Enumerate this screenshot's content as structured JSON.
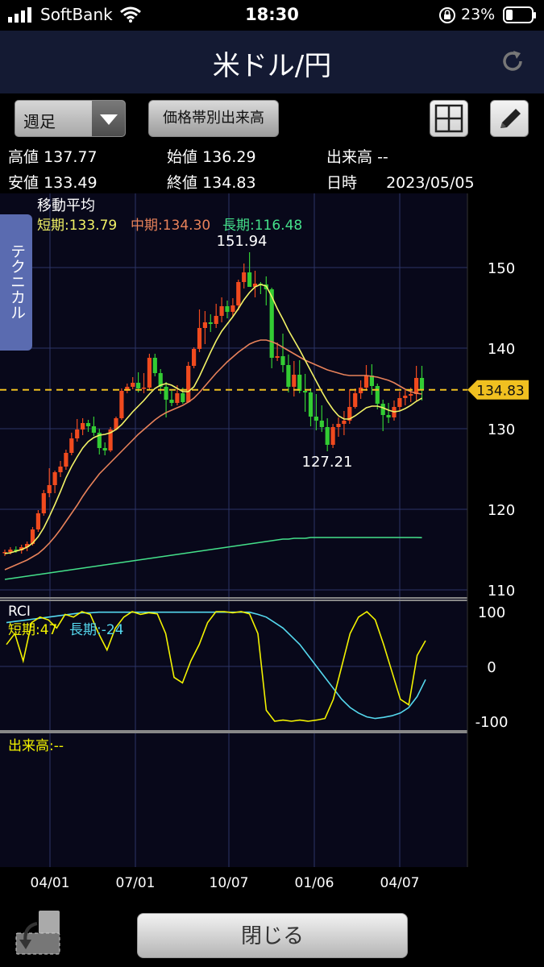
{
  "status_bar": {
    "carrier": "SoftBank",
    "time": "18:30",
    "battery": "23%"
  },
  "header": {
    "title": "米ドル/円"
  },
  "toolbar": {
    "period": "週足",
    "volume_button": "価格帯別出来高"
  },
  "ohlc": {
    "high_label": "高値",
    "high": "137.77",
    "open_label": "始値",
    "open": "136.29",
    "volume_label": "出来高",
    "volume": "--",
    "low_label": "安値",
    "low": "133.49",
    "close_label": "終値",
    "close": "134.83",
    "date_label": "日時",
    "date": "2023/05/05"
  },
  "side_tab": {
    "label": "テクニカル"
  },
  "close_button": {
    "label": "閉じる"
  },
  "colors": {
    "up": "#f04a1e",
    "down": "#33cc33",
    "ma_short": "#f2f266",
    "ma_mid": "#e8825a",
    "ma_long": "#44e08a",
    "rci_short": "#f2f200",
    "rci_long": "#55d8ee",
    "grid": "#2c3566",
    "price_tag": "#f0c020"
  },
  "chart_data": [
    {
      "type": "candlestick",
      "title": "移動平均",
      "legend": [
        {
          "label": "短期",
          "value": "133.79"
        },
        {
          "label": "中期",
          "value": "134.30"
        },
        {
          "label": "長期",
          "value": "116.48"
        }
      ],
      "x_ticks": [
        "04/01",
        "07/01",
        "10/07",
        "01/06",
        "04/07"
      ],
      "y_ticks": [
        110,
        120,
        130,
        140,
        150
      ],
      "ylim": [
        109,
        158
      ],
      "current_price": 134.83,
      "current_price_label": "134.83",
      "high_annotation": {
        "value": 151.94,
        "label": "151.94"
      },
      "low_annotation": {
        "value": 127.21,
        "label": "127.21"
      },
      "candles": [
        [
          114.6,
          115.0,
          114.2,
          114.7
        ],
        [
          114.7,
          115.3,
          114.4,
          115.0
        ],
        [
          115.0,
          115.4,
          114.6,
          114.9
        ],
        [
          114.9,
          115.6,
          114.5,
          115.3
        ],
        [
          115.3,
          116.0,
          114.8,
          115.7
        ],
        [
          115.7,
          117.8,
          115.5,
          117.5
        ],
        [
          117.5,
          119.9,
          117.2,
          119.5
        ],
        [
          119.5,
          122.4,
          119.2,
          122.0
        ],
        [
          122.0,
          125.1,
          121.5,
          123.0
        ],
        [
          123.0,
          124.8,
          122.0,
          124.6
        ],
        [
          124.6,
          126.0,
          124.0,
          125.3
        ],
        [
          125.3,
          127.4,
          124.9,
          127.0
        ],
        [
          127.0,
          129.5,
          126.7,
          128.8
        ],
        [
          128.8,
          131.2,
          128.4,
          129.9
        ],
        [
          129.9,
          131.3,
          129.2,
          130.7
        ],
        [
          130.7,
          131.1,
          129.6,
          130.3
        ],
        [
          130.3,
          131.5,
          129.1,
          129.5
        ],
        [
          129.5,
          130.0,
          126.8,
          127.6
        ],
        [
          127.6,
          128.3,
          126.7,
          127.3
        ],
        [
          127.3,
          130.2,
          127.1,
          129.9
        ],
        [
          129.9,
          131.5,
          129.8,
          131.3
        ],
        [
          131.3,
          135.0,
          131.1,
          134.7
        ],
        [
          134.7,
          135.6,
          134.4,
          135.2
        ],
        [
          135.2,
          136.4,
          134.9,
          135.7
        ],
        [
          135.7,
          137.0,
          134.5,
          135.0
        ],
        [
          135.0,
          136.9,
          134.4,
          135.1
        ],
        [
          135.1,
          139.3,
          134.9,
          138.8
        ],
        [
          138.8,
          139.3,
          136.5,
          136.9
        ],
        [
          136.9,
          137.4,
          134.3,
          135.2
        ],
        [
          135.2,
          135.8,
          131.4,
          133.6
        ],
        [
          133.6,
          134.7,
          132.8,
          133.2
        ],
        [
          133.2,
          135.4,
          132.9,
          134.4
        ],
        [
          134.4,
          135.1,
          133.1,
          133.3
        ],
        [
          133.3,
          138.3,
          133.2,
          137.8
        ],
        [
          137.8,
          140.1,
          137.5,
          139.9
        ],
        [
          139.9,
          144.8,
          139.5,
          142.5
        ],
        [
          142.5,
          144.6,
          140.5,
          143.2
        ],
        [
          143.2,
          144.2,
          142.0,
          143.0
        ],
        [
          143.0,
          145.5,
          142.5,
          144.0
        ],
        [
          144.0,
          146.3,
          143.2,
          145.2
        ],
        [
          145.2,
          145.9,
          143.7,
          144.5
        ],
        [
          144.5,
          146.2,
          143.9,
          145.3
        ],
        [
          145.3,
          148.5,
          144.7,
          148.2
        ],
        [
          148.2,
          150.5,
          147.4,
          149.4
        ],
        [
          149.4,
          151.9,
          148.8,
          147.6
        ],
        [
          147.6,
          149.6,
          146.3,
          148.0
        ],
        [
          148.0,
          148.2,
          146.7,
          147.9
        ],
        [
          147.9,
          148.9,
          145.3,
          147.3
        ],
        [
          147.3,
          147.5,
          137.5,
          138.8
        ],
        [
          138.8,
          140.7,
          138.4,
          139.0
        ],
        [
          139.0,
          141.8,
          137.0,
          137.9
        ],
        [
          137.9,
          139.2,
          134.5,
          135.2
        ],
        [
          135.2,
          138.4,
          134.0,
          136.7
        ],
        [
          136.7,
          138.5,
          134.4,
          134.7
        ],
        [
          134.7,
          136.8,
          132.1,
          134.5
        ],
        [
          134.5,
          135.0,
          130.3,
          131.5
        ],
        [
          131.5,
          134.3,
          129.8,
          131.0
        ],
        [
          131.0,
          132.9,
          129.6,
          130.2
        ],
        [
          130.2,
          131.3,
          127.2,
          128.0
        ],
        [
          128.0,
          130.6,
          127.6,
          130.2
        ],
        [
          130.2,
          131.4,
          129.0,
          130.6
        ],
        [
          130.6,
          132.2,
          129.2,
          131.0
        ],
        [
          131.0,
          134.9,
          130.6,
          132.7
        ],
        [
          132.7,
          135.0,
          132.5,
          134.4
        ],
        [
          134.4,
          136.0,
          133.7,
          135.1
        ],
        [
          135.1,
          137.9,
          134.7,
          136.6
        ],
        [
          136.6,
          138.0,
          134.2,
          135.3
        ],
        [
          135.3,
          135.6,
          132.4,
          133.1
        ],
        [
          133.1,
          133.6,
          129.7,
          131.7
        ],
        [
          131.7,
          133.2,
          130.7,
          131.4
        ],
        [
          131.4,
          133.5,
          131.0,
          132.7
        ],
        [
          132.7,
          134.6,
          132.2,
          133.8
        ],
        [
          133.8,
          134.8,
          132.9,
          134.1
        ],
        [
          134.1,
          135.1,
          133.3,
          134.3
        ],
        [
          134.3,
          137.8,
          133.5,
          136.3
        ],
        [
          136.3,
          137.8,
          133.5,
          134.8
        ]
      ],
      "ma_short": [
        114.5,
        114.6,
        114.8,
        115.0,
        115.3,
        115.8,
        116.6,
        117.7,
        119.1,
        120.6,
        122.2,
        123.9,
        125.3,
        126.5,
        127.6,
        128.4,
        128.9,
        129.2,
        129.3,
        129.5,
        129.9,
        130.5,
        131.3,
        132.1,
        132.8,
        133.5,
        134.3,
        135.0,
        135.4,
        135.6,
        135.4,
        135.0,
        134.6,
        134.6,
        135.2,
        136.5,
        138.0,
        139.5,
        140.9,
        142.1,
        143.0,
        143.9,
        144.9,
        146.0,
        146.9,
        147.6,
        147.9,
        147.7,
        146.4,
        144.9,
        143.6,
        142.2,
        141.0,
        139.8,
        138.5,
        137.2,
        135.9,
        134.6,
        133.4,
        132.4,
        131.6,
        131.2,
        131.2,
        131.6,
        132.1,
        132.6,
        132.8,
        132.8,
        132.6,
        132.3,
        132.1,
        132.2,
        132.5,
        132.9,
        133.4,
        133.79
      ],
      "ma_mid": [
        112.5,
        112.8,
        113.1,
        113.4,
        113.7,
        114.1,
        114.5,
        115.1,
        115.8,
        116.6,
        117.5,
        118.5,
        119.5,
        120.5,
        121.6,
        122.6,
        123.5,
        124.4,
        125.1,
        125.8,
        126.5,
        127.2,
        127.9,
        128.6,
        129.3,
        129.9,
        130.5,
        131.1,
        131.6,
        132.0,
        132.3,
        132.6,
        132.9,
        133.3,
        133.8,
        134.5,
        135.3,
        136.1,
        136.9,
        137.6,
        138.3,
        138.9,
        139.5,
        140.0,
        140.5,
        140.8,
        141.0,
        141.0,
        140.8,
        140.5,
        140.1,
        139.7,
        139.3,
        138.9,
        138.5,
        138.2,
        137.9,
        137.6,
        137.3,
        137.1,
        136.9,
        136.7,
        136.6,
        136.6,
        136.6,
        136.6,
        136.5,
        136.4,
        136.2,
        136.0,
        135.7,
        135.3,
        134.9,
        134.6,
        134.4,
        134.3
      ],
      "ma_long": [
        111.3,
        111.4,
        111.5,
        111.6,
        111.7,
        111.8,
        111.9,
        112.0,
        112.1,
        112.2,
        112.3,
        112.4,
        112.5,
        112.6,
        112.7,
        112.8,
        112.9,
        113.0,
        113.1,
        113.2,
        113.3,
        113.4,
        113.5,
        113.6,
        113.7,
        113.8,
        113.9,
        114.0,
        114.1,
        114.2,
        114.3,
        114.4,
        114.5,
        114.6,
        114.7,
        114.8,
        114.9,
        115.0,
        115.1,
        115.2,
        115.3,
        115.4,
        115.5,
        115.6,
        115.7,
        115.8,
        115.9,
        116.0,
        116.1,
        116.2,
        116.3,
        116.3,
        116.4,
        116.4,
        116.4,
        116.5,
        116.5,
        116.5,
        116.5,
        116.5,
        116.5,
        116.5,
        116.5,
        116.5,
        116.5,
        116.5,
        116.5,
        116.5,
        116.5,
        116.5,
        116.5,
        116.5,
        116.5,
        116.5,
        116.5,
        116.48
      ]
    },
    {
      "type": "line",
      "title": "RCI",
      "legend": [
        {
          "label": "短期",
          "value": "47"
        },
        {
          "label": "長期",
          "value": "-24"
        }
      ],
      "y_ticks": [
        100,
        0,
        -100
      ],
      "ylim": [
        -120,
        120
      ],
      "rci_short": [
        40,
        60,
        10,
        80,
        90,
        85,
        70,
        95,
        90,
        100,
        95,
        60,
        30,
        70,
        90,
        100,
        95,
        98,
        96,
        60,
        -20,
        -30,
        10,
        40,
        80,
        100,
        100,
        98,
        100,
        96,
        60,
        -80,
        -100,
        -98,
        -100,
        -98,
        -100,
        -98,
        -95,
        -60,
        0,
        60,
        90,
        100,
        85,
        40,
        -10,
        -60,
        -70,
        20,
        47
      ],
      "rci_long": [
        80,
        82,
        84,
        86,
        88,
        90,
        92,
        94,
        96,
        98,
        98,
        99,
        99,
        99,
        99,
        99,
        99,
        99,
        99,
        99,
        99,
        99,
        99,
        99,
        99,
        99,
        99,
        99,
        99,
        99,
        95,
        90,
        80,
        70,
        55,
        40,
        20,
        0,
        -20,
        -40,
        -60,
        -75,
        -85,
        -92,
        -95,
        -93,
        -90,
        -85,
        -75,
        -55,
        -24
      ]
    },
    {
      "type": "bar",
      "title": "出来高",
      "value": "--",
      "values": []
    }
  ]
}
